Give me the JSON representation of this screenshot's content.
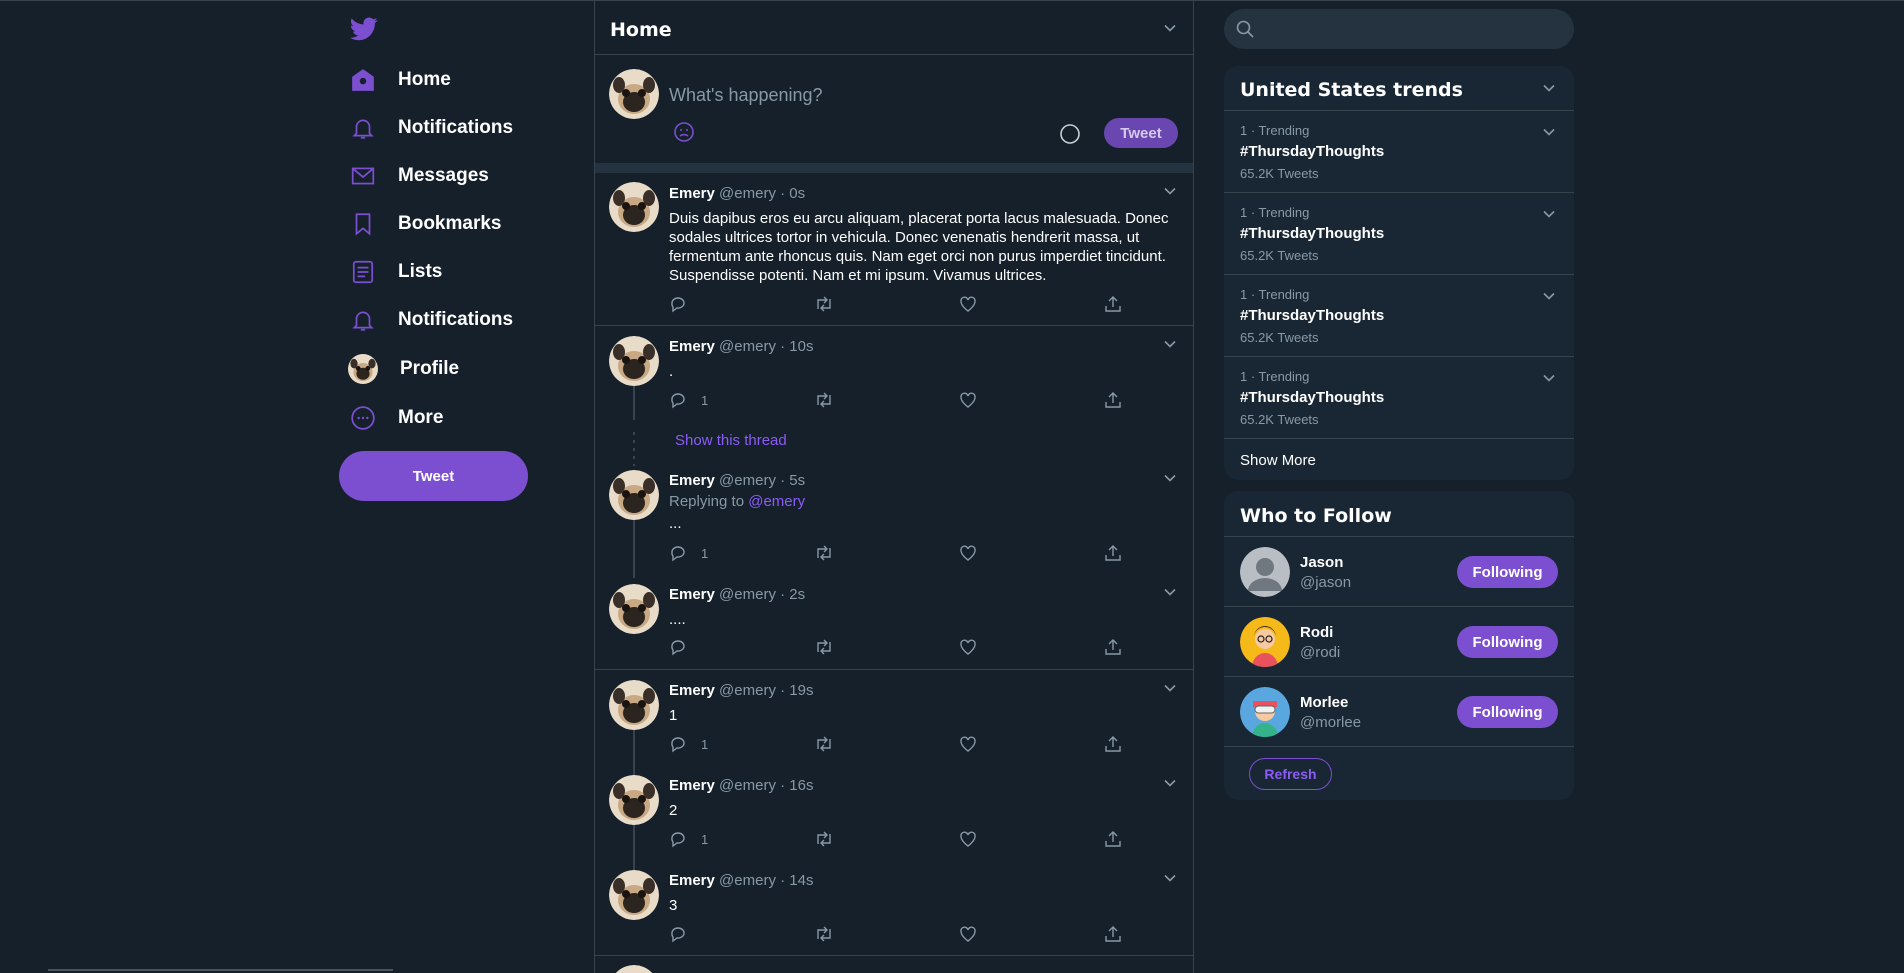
{
  "colors": {
    "accent": "#7b4fcf",
    "background": "#15202b",
    "panel": "#192734",
    "muted": "#8899a6",
    "link": "#8b5cf6"
  },
  "nav": {
    "logo_icon": "bird-icon",
    "items": [
      {
        "label": "Home",
        "icon": "home-icon"
      },
      {
        "label": "Notifications",
        "icon": "bell-icon"
      },
      {
        "label": "Messages",
        "icon": "envelope-icon"
      },
      {
        "label": "Bookmarks",
        "icon": "bookmark-icon"
      },
      {
        "label": "Lists",
        "icon": "list-icon"
      },
      {
        "label": "Notifications",
        "icon": "bell-icon"
      },
      {
        "label": "Profile",
        "icon": "avatar"
      },
      {
        "label": "More",
        "icon": "more-icon"
      }
    ],
    "tweet_button": "Tweet"
  },
  "header": {
    "title": "Home"
  },
  "compose": {
    "placeholder": "What's happening?",
    "tweet_button": "Tweet"
  },
  "tweets": [
    {
      "name": "Emery",
      "meta": "@emery · 0s",
      "text": "Duis dapibus eros eu arcu aliquam, placerat porta lacus malesuada. Donec sodales ultrices tortor in vehicula. Donec venenatis hendrerit massa, ut fermentum ante rhoncus quis. Nam eget orci non purus imperdiet tincidunt. Suspendisse potenti. Nam et mi ipsum. Vivamus ultrices.",
      "replies": ""
    },
    {
      "name": "Emery",
      "meta": "@emery · 10s",
      "text": ".",
      "replies": "1"
    },
    {
      "name": "Emery",
      "meta": "@emery · 5s",
      "replying_label": "Replying to",
      "replying_to": "@emery",
      "text": "...",
      "replies": "1"
    },
    {
      "name": "Emery",
      "meta": "@emery · 2s",
      "text": "....",
      "replies": ""
    },
    {
      "name": "Emery",
      "meta": "@emery · 19s",
      "text": "1",
      "replies": "1"
    },
    {
      "name": "Emery",
      "meta": "@emery · 16s",
      "text": "2",
      "replies": "1"
    },
    {
      "name": "Emery",
      "meta": "@emery · 14s",
      "text": "3",
      "replies": ""
    }
  ],
  "show_thread": "Show this thread",
  "search": {
    "placeholder": ""
  },
  "trends": {
    "title": "United States trends",
    "items": [
      {
        "meta": "1 · Trending",
        "tag": "#ThursdayThoughts",
        "count": "65.2K Tweets"
      },
      {
        "meta": "1 · Trending",
        "tag": "#ThursdayThoughts",
        "count": "65.2K Tweets"
      },
      {
        "meta": "1 · Trending",
        "tag": "#ThursdayThoughts",
        "count": "65.2K Tweets"
      },
      {
        "meta": "1 · Trending",
        "tag": "#ThursdayThoughts",
        "count": "65.2K Tweets"
      }
    ],
    "show_more": "Show More"
  },
  "who_to_follow": {
    "title": "Who to Follow",
    "items": [
      {
        "name": "Jason",
        "handle": "@jason",
        "button": "Following"
      },
      {
        "name": "Rodi",
        "handle": "@rodi",
        "button": "Following"
      },
      {
        "name": "Morlee",
        "handle": "@morlee",
        "button": "Following"
      }
    ],
    "refresh": "Refresh"
  }
}
